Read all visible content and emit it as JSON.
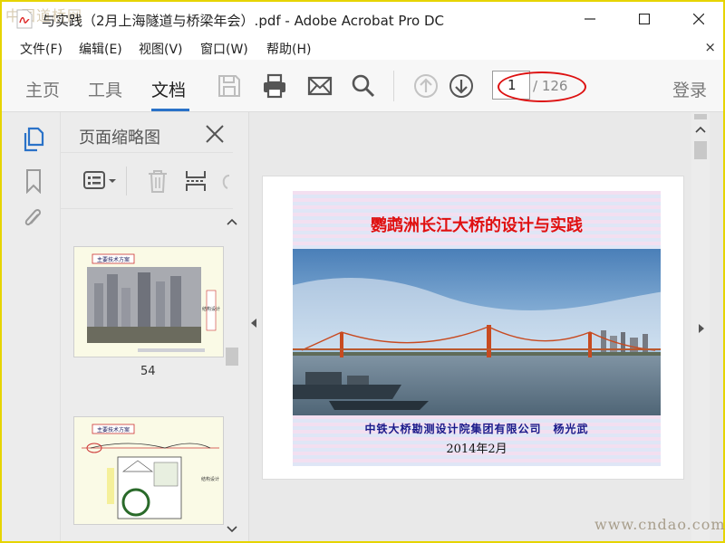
{
  "window": {
    "title": "与实践（2月上海隧道与桥梁年会）.pdf - Adobe Acrobat Pro DC",
    "watermark_top": "中国道桥网",
    "watermark_bottom": "www.cndao.com"
  },
  "menubar": {
    "items": [
      "文件(F)",
      "编辑(E)",
      "视图(V)",
      "窗口(W)",
      "帮助(H)"
    ],
    "close": "×"
  },
  "toolbar": {
    "tabs": [
      "主页",
      "工具",
      "文档"
    ],
    "active_tab": "文档",
    "page_current": "1",
    "page_total": "/ 126",
    "login": "登录",
    "icons": [
      "save-icon",
      "print-icon",
      "email-icon",
      "search-icon",
      "prev-page-icon",
      "next-page-icon"
    ]
  },
  "sidebar_panel": {
    "title": "页面缩略图",
    "thumbnails": [
      {
        "page": "54",
        "heading": "主要技术方案",
        "side": "结构设计"
      },
      {
        "page": "",
        "heading": "主要技术方案",
        "side": "结构设计"
      }
    ]
  },
  "slide": {
    "title": "鹦鹉洲长江大桥的设计与实践",
    "org": "中铁大桥勘测设计院集团有限公司　杨光武",
    "date": "2014年2月"
  },
  "colors": {
    "accent": "#2a72c8",
    "highlight_oval": "#dd1111",
    "slide_title": "#e01010",
    "frame": "#e6d400"
  }
}
